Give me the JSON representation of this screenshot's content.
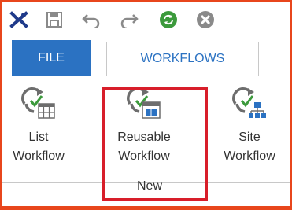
{
  "colors": {
    "frame": "#e8461c",
    "file_tab_bg": "#2b72c2",
    "highlight": "#d81e2a",
    "icon_gray": "#6d6d6d",
    "icon_green": "#3c9a3c"
  },
  "quick_access": [
    {
      "icon": "close-x-icon"
    },
    {
      "icon": "save-icon"
    },
    {
      "icon": "undo-icon"
    },
    {
      "icon": "redo-icon"
    },
    {
      "icon": "refresh-icon"
    },
    {
      "icon": "cancel-icon"
    }
  ],
  "tabs": {
    "file": "FILE",
    "workflows": "WORKFLOWS"
  },
  "ribbon": {
    "list_workflow": {
      "line1": "List",
      "line2": "Workflow",
      "icon": "list-workflow-icon"
    },
    "reusable_workflow": {
      "line1": "Reusable",
      "line2": "Workflow",
      "icon": "reusable-workflow-icon"
    },
    "site_workflow": {
      "line1": "Site",
      "line2": "Workflow",
      "icon": "site-workflow-icon"
    },
    "group_label": "New"
  }
}
